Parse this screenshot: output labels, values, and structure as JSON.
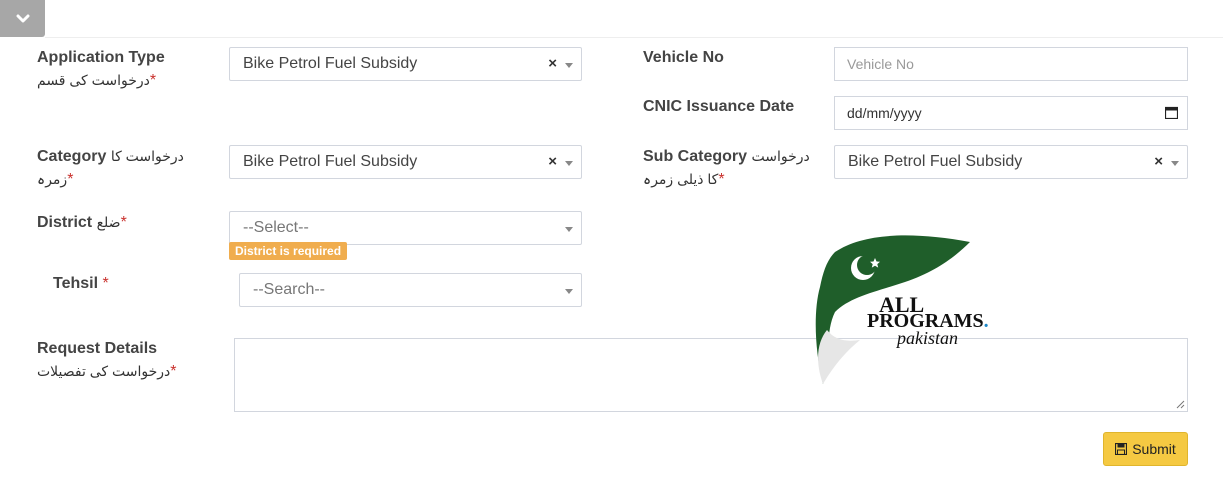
{
  "form": {
    "application_type": {
      "label": "Application Type",
      "urdu": "درخواست کی قسم",
      "required": "*",
      "value": "Bike Petrol Fuel Subsidy",
      "clear": "×"
    },
    "vehicle_no": {
      "label": "Vehicle No",
      "placeholder": "Vehicle No"
    },
    "cnic_date": {
      "label": "CNIC Issuance Date",
      "placeholder": "dd/mm/yyyy"
    },
    "category": {
      "label": "Category",
      "urdu_inline": "درخواست کا",
      "urdu_line2": "زمرہ",
      "required": "*",
      "value": "Bike Petrol Fuel Subsidy",
      "clear": "×"
    },
    "sub_category": {
      "label": "Sub Category",
      "urdu_inline": "درخواست",
      "urdu_line2": "کا ذیلی زمرہ",
      "required": "*",
      "value": "Bike Petrol Fuel Subsidy",
      "clear": "×"
    },
    "district": {
      "label": "District",
      "urdu": "ضلع",
      "required": "*",
      "value": "--Select--",
      "error": "District is required"
    },
    "tehsil": {
      "label": "Tehsil",
      "required": "*",
      "value": "--Search--"
    },
    "request_details": {
      "label": "Request Details",
      "urdu": "درخواست کی تفصیلات",
      "required": "*"
    },
    "submit_label": "Submit"
  },
  "watermark": {
    "line1": "ALL",
    "line2": "PROGRAMS",
    "dot": ".",
    "line3": "pakistan"
  },
  "colors": {
    "badge": "#f0ad4e",
    "submit": "#f5c942",
    "flag_green": "#1f5e2a"
  }
}
